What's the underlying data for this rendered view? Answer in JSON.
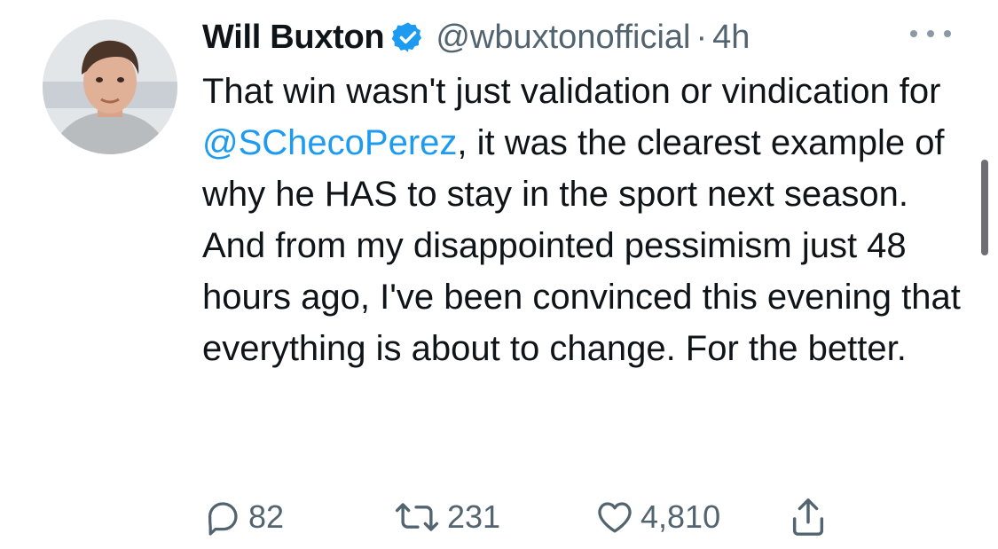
{
  "tweet": {
    "author_name": "Will Buxton",
    "handle": "@wbuxtonofficial",
    "separator": "·",
    "time": "4h",
    "text_before_mention": "That win wasn't just validation or vindication for ",
    "mention": "@SChecoPerez",
    "text_after_mention": ", it was the clearest example of why he HAS to stay in the sport next season. And from my disappointed pessimism just 48 hours ago, I've been convinced this evening that everything is about to change. For the better."
  },
  "actions": {
    "replies": "82",
    "retweets": "231",
    "likes": "4,810"
  },
  "icons": {
    "verified": "verified-badge-icon",
    "more": "more-icon",
    "reply": "reply-icon",
    "retweet": "retweet-icon",
    "like": "heart-icon",
    "share": "share-icon"
  },
  "colors": {
    "accent": "#1d9bf0",
    "text": "#0f1419",
    "secondary": "#536471"
  }
}
